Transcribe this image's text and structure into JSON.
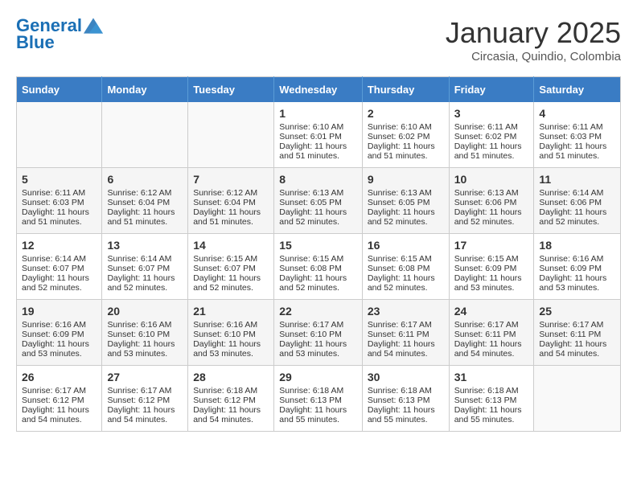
{
  "header": {
    "logo_line1": "General",
    "logo_line2": "Blue",
    "month": "January 2025",
    "location": "Circasia, Quindio, Colombia"
  },
  "weekdays": [
    "Sunday",
    "Monday",
    "Tuesday",
    "Wednesday",
    "Thursday",
    "Friday",
    "Saturday"
  ],
  "weeks": [
    [
      {
        "day": "",
        "info": ""
      },
      {
        "day": "",
        "info": ""
      },
      {
        "day": "",
        "info": ""
      },
      {
        "day": "1",
        "info": "Sunrise: 6:10 AM\nSunset: 6:01 PM\nDaylight: 11 hours and 51 minutes."
      },
      {
        "day": "2",
        "info": "Sunrise: 6:10 AM\nSunset: 6:02 PM\nDaylight: 11 hours and 51 minutes."
      },
      {
        "day": "3",
        "info": "Sunrise: 6:11 AM\nSunset: 6:02 PM\nDaylight: 11 hours and 51 minutes."
      },
      {
        "day": "4",
        "info": "Sunrise: 6:11 AM\nSunset: 6:03 PM\nDaylight: 11 hours and 51 minutes."
      }
    ],
    [
      {
        "day": "5",
        "info": "Sunrise: 6:11 AM\nSunset: 6:03 PM\nDaylight: 11 hours and 51 minutes."
      },
      {
        "day": "6",
        "info": "Sunrise: 6:12 AM\nSunset: 6:04 PM\nDaylight: 11 hours and 51 minutes."
      },
      {
        "day": "7",
        "info": "Sunrise: 6:12 AM\nSunset: 6:04 PM\nDaylight: 11 hours and 51 minutes."
      },
      {
        "day": "8",
        "info": "Sunrise: 6:13 AM\nSunset: 6:05 PM\nDaylight: 11 hours and 52 minutes."
      },
      {
        "day": "9",
        "info": "Sunrise: 6:13 AM\nSunset: 6:05 PM\nDaylight: 11 hours and 52 minutes."
      },
      {
        "day": "10",
        "info": "Sunrise: 6:13 AM\nSunset: 6:06 PM\nDaylight: 11 hours and 52 minutes."
      },
      {
        "day": "11",
        "info": "Sunrise: 6:14 AM\nSunset: 6:06 PM\nDaylight: 11 hours and 52 minutes."
      }
    ],
    [
      {
        "day": "12",
        "info": "Sunrise: 6:14 AM\nSunset: 6:07 PM\nDaylight: 11 hours and 52 minutes."
      },
      {
        "day": "13",
        "info": "Sunrise: 6:14 AM\nSunset: 6:07 PM\nDaylight: 11 hours and 52 minutes."
      },
      {
        "day": "14",
        "info": "Sunrise: 6:15 AM\nSunset: 6:07 PM\nDaylight: 11 hours and 52 minutes."
      },
      {
        "day": "15",
        "info": "Sunrise: 6:15 AM\nSunset: 6:08 PM\nDaylight: 11 hours and 52 minutes."
      },
      {
        "day": "16",
        "info": "Sunrise: 6:15 AM\nSunset: 6:08 PM\nDaylight: 11 hours and 52 minutes."
      },
      {
        "day": "17",
        "info": "Sunrise: 6:15 AM\nSunset: 6:09 PM\nDaylight: 11 hours and 53 minutes."
      },
      {
        "day": "18",
        "info": "Sunrise: 6:16 AM\nSunset: 6:09 PM\nDaylight: 11 hours and 53 minutes."
      }
    ],
    [
      {
        "day": "19",
        "info": "Sunrise: 6:16 AM\nSunset: 6:09 PM\nDaylight: 11 hours and 53 minutes."
      },
      {
        "day": "20",
        "info": "Sunrise: 6:16 AM\nSunset: 6:10 PM\nDaylight: 11 hours and 53 minutes."
      },
      {
        "day": "21",
        "info": "Sunrise: 6:16 AM\nSunset: 6:10 PM\nDaylight: 11 hours and 53 minutes."
      },
      {
        "day": "22",
        "info": "Sunrise: 6:17 AM\nSunset: 6:10 PM\nDaylight: 11 hours and 53 minutes."
      },
      {
        "day": "23",
        "info": "Sunrise: 6:17 AM\nSunset: 6:11 PM\nDaylight: 11 hours and 54 minutes."
      },
      {
        "day": "24",
        "info": "Sunrise: 6:17 AM\nSunset: 6:11 PM\nDaylight: 11 hours and 54 minutes."
      },
      {
        "day": "25",
        "info": "Sunrise: 6:17 AM\nSunset: 6:11 PM\nDaylight: 11 hours and 54 minutes."
      }
    ],
    [
      {
        "day": "26",
        "info": "Sunrise: 6:17 AM\nSunset: 6:12 PM\nDaylight: 11 hours and 54 minutes."
      },
      {
        "day": "27",
        "info": "Sunrise: 6:17 AM\nSunset: 6:12 PM\nDaylight: 11 hours and 54 minutes."
      },
      {
        "day": "28",
        "info": "Sunrise: 6:18 AM\nSunset: 6:12 PM\nDaylight: 11 hours and 54 minutes."
      },
      {
        "day": "29",
        "info": "Sunrise: 6:18 AM\nSunset: 6:13 PM\nDaylight: 11 hours and 55 minutes."
      },
      {
        "day": "30",
        "info": "Sunrise: 6:18 AM\nSunset: 6:13 PM\nDaylight: 11 hours and 55 minutes."
      },
      {
        "day": "31",
        "info": "Sunrise: 6:18 AM\nSunset: 6:13 PM\nDaylight: 11 hours and 55 minutes."
      },
      {
        "day": "",
        "info": ""
      }
    ]
  ]
}
